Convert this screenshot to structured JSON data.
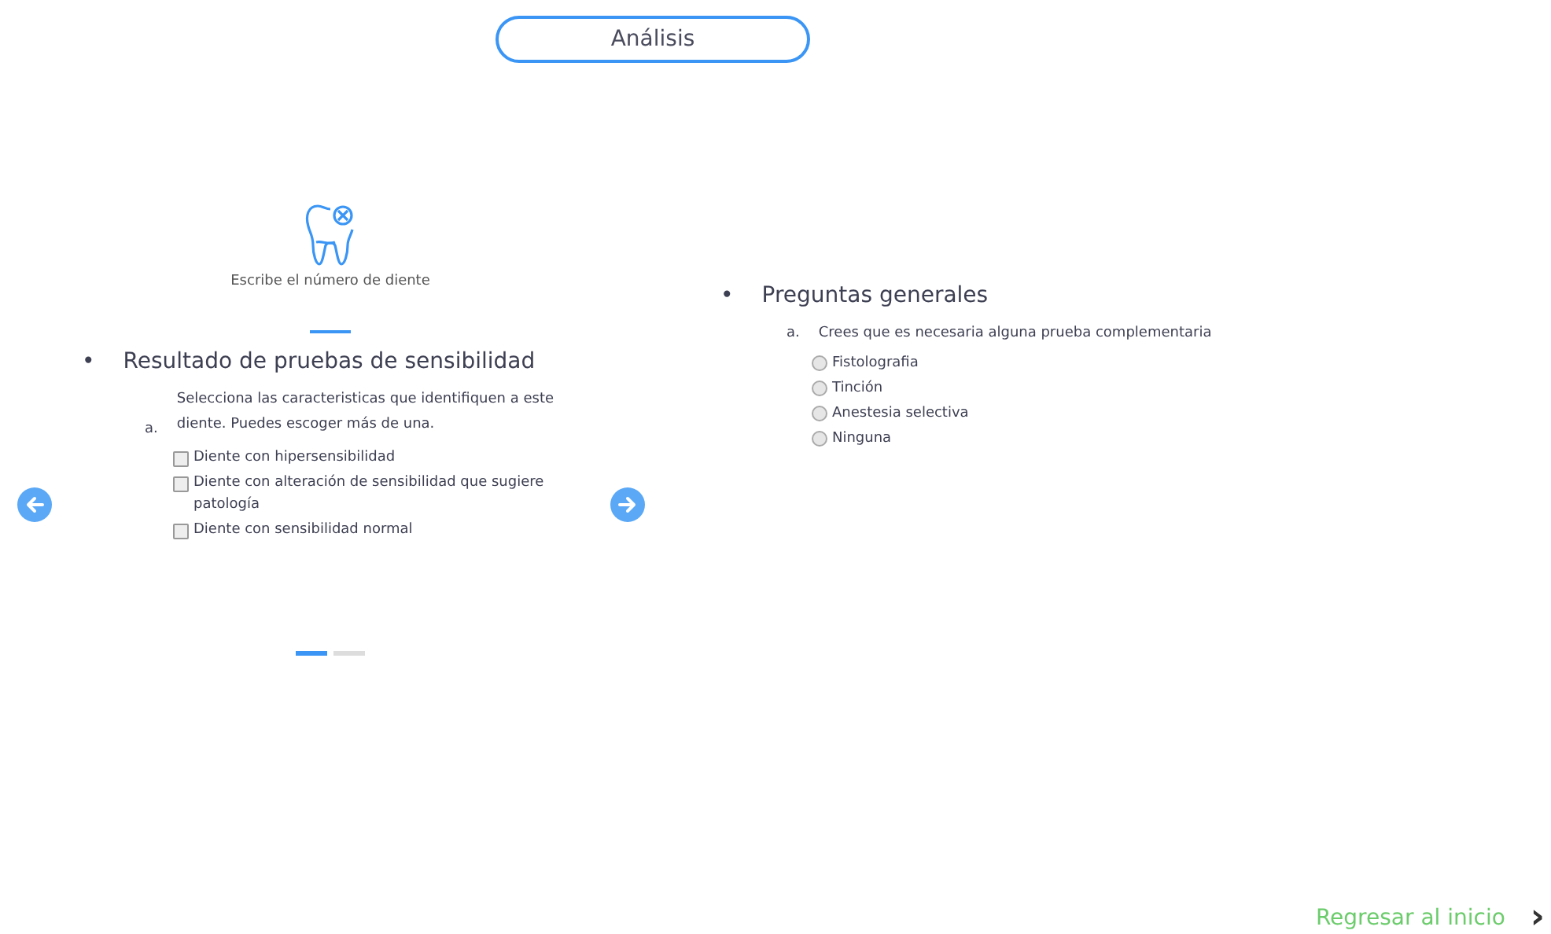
{
  "header": {
    "title": "Análisis"
  },
  "carousel": {
    "tooth_caption": "Escribe el número de diente",
    "section": {
      "bullet": "•",
      "title": "Resultado de pruebas de sensibilidad",
      "question": {
        "marker": "a.",
        "text": "Selecciona las caracteristicas que identifiquen a este diente. Puedes escoger más de una.",
        "options": [
          {
            "label": "Diente con hipersensibilidad",
            "checked": false
          },
          {
            "label": "Diente con alteración de sensibilidad que sugiere patología",
            "checked": false
          },
          {
            "label": "Diente con sensibilidad normal",
            "checked": false
          }
        ]
      }
    },
    "pages": [
      {
        "selected": true
      },
      {
        "selected": false
      }
    ]
  },
  "general": {
    "bullet": "•",
    "title": "Preguntas generales",
    "question": {
      "marker": "a.",
      "text": "Crees que es necesaria alguna prueba complementaria",
      "options": [
        {
          "label": "Fistolografia",
          "selected": false
        },
        {
          "label": "Tinción",
          "selected": false
        },
        {
          "label": "Anestesia selectiva",
          "selected": false
        },
        {
          "label": "Ninguna",
          "selected": false
        }
      ]
    }
  },
  "footer": {
    "link": "Regresar al inicio",
    "arrow": "›"
  }
}
